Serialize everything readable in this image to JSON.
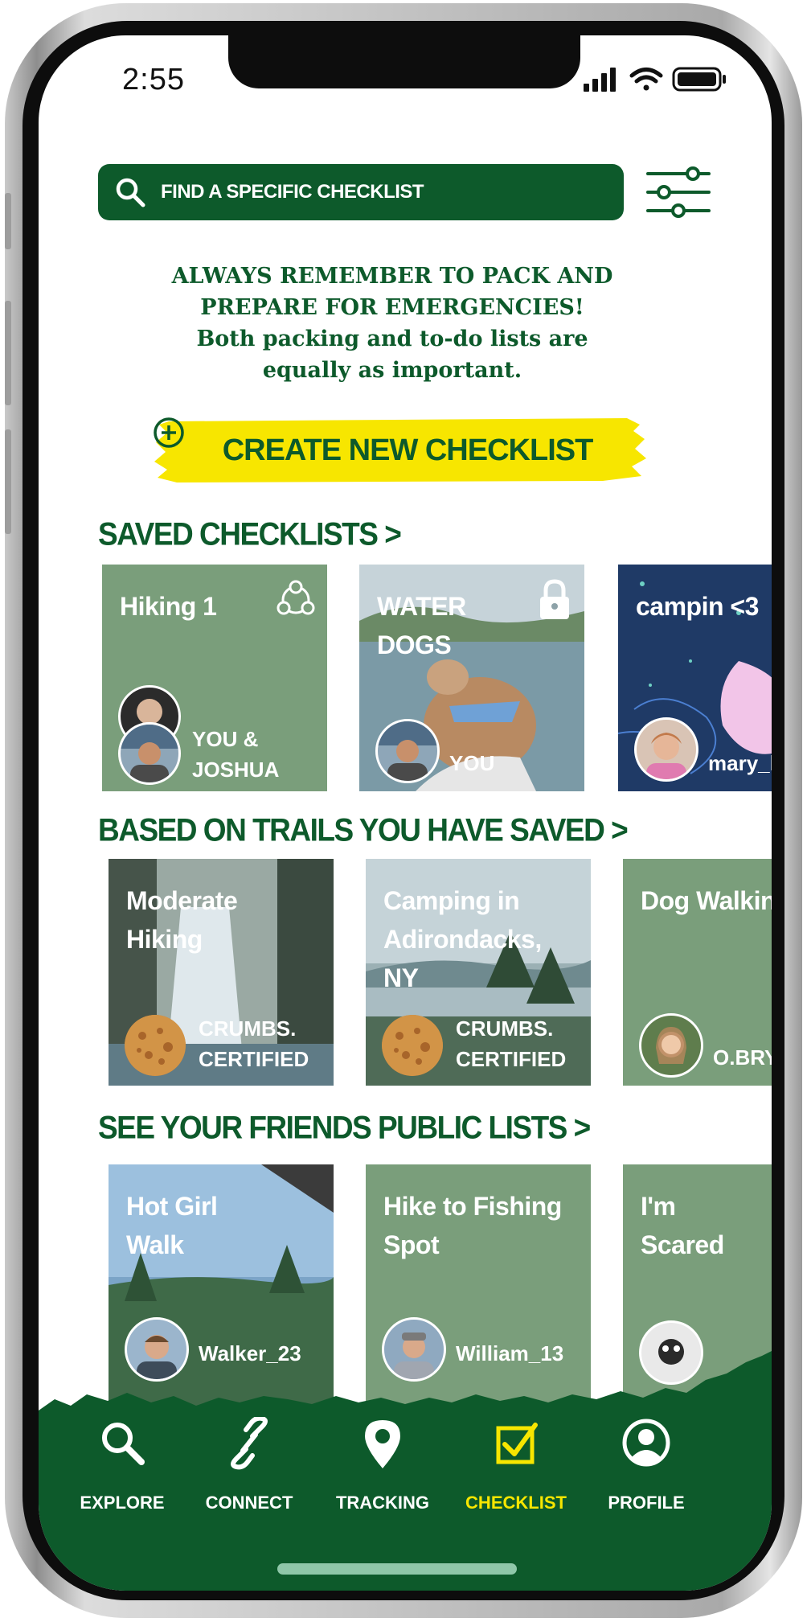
{
  "status_bar": {
    "time": "2:55",
    "signal_icon": "cellular-signal-icon",
    "wifi_icon": "wifi-icon",
    "battery_icon": "battery-icon"
  },
  "search": {
    "placeholder": "FIND A SPECIFIC CHECKLIST",
    "icon": "search-icon",
    "filter_icon": "filter-sliders-icon"
  },
  "tagline": {
    "line1": "ALWAYS REMEMBER TO PACK AND",
    "line2": "PREPARE FOR EMERGENCIES!",
    "line3": "Both packing and to-do lists are",
    "line4": "equally as important."
  },
  "create_button": {
    "label": "CREATE NEW CHECKLIST",
    "icon": "plus-circle-icon"
  },
  "saved_checklists": {
    "title": "SAVED CHECKLISTS >",
    "cards": [
      {
        "title": "Hiking 1",
        "owner": "YOU &\nJOSHUA",
        "icon": "shared-group-icon"
      },
      {
        "title": "WATER\nDOGS",
        "owner": "YOU",
        "icon": "lock-icon"
      },
      {
        "title": "campin <3",
        "owner": "mary_l"
      }
    ]
  },
  "trail_checklists": {
    "title": "BASED ON TRAILS YOU HAVE SAVED >",
    "cards": [
      {
        "title": "Moderate\nHiking",
        "owner": "CRUMBS.\nCERTIFIED"
      },
      {
        "title": "Camping in\nAdirondacks, NY",
        "owner": "CRUMBS.\nCERTIFIED"
      },
      {
        "title": "Dog Walkin",
        "owner": "O.BRYI"
      }
    ]
  },
  "friends_lists": {
    "title": "SEE YOUR FRIENDS PUBLIC LISTS >",
    "cards": [
      {
        "title": "Hot Girl\nWalk",
        "owner": "Walker_23"
      },
      {
        "title": "Hike to Fishing\nSpot",
        "owner": "William_13"
      },
      {
        "title": "I'm\nScared",
        "owner": ""
      }
    ]
  },
  "nav": {
    "items": [
      {
        "label": "EXPLORE",
        "icon": "search-icon",
        "active": false
      },
      {
        "label": "CONNECT",
        "icon": "link-icon",
        "active": false
      },
      {
        "label": "TRACKING",
        "icon": "map-pin-icon",
        "active": false
      },
      {
        "label": "CHECKLIST",
        "icon": "checkbox-icon",
        "active": true
      },
      {
        "label": "PROFILE",
        "icon": "user-circle-icon",
        "active": false
      }
    ]
  },
  "colors": {
    "primary_green": "#0d5a2b",
    "card_green": "#7a9e7b",
    "accent_yellow": "#f7e600",
    "active_nav": "#f7e600"
  }
}
